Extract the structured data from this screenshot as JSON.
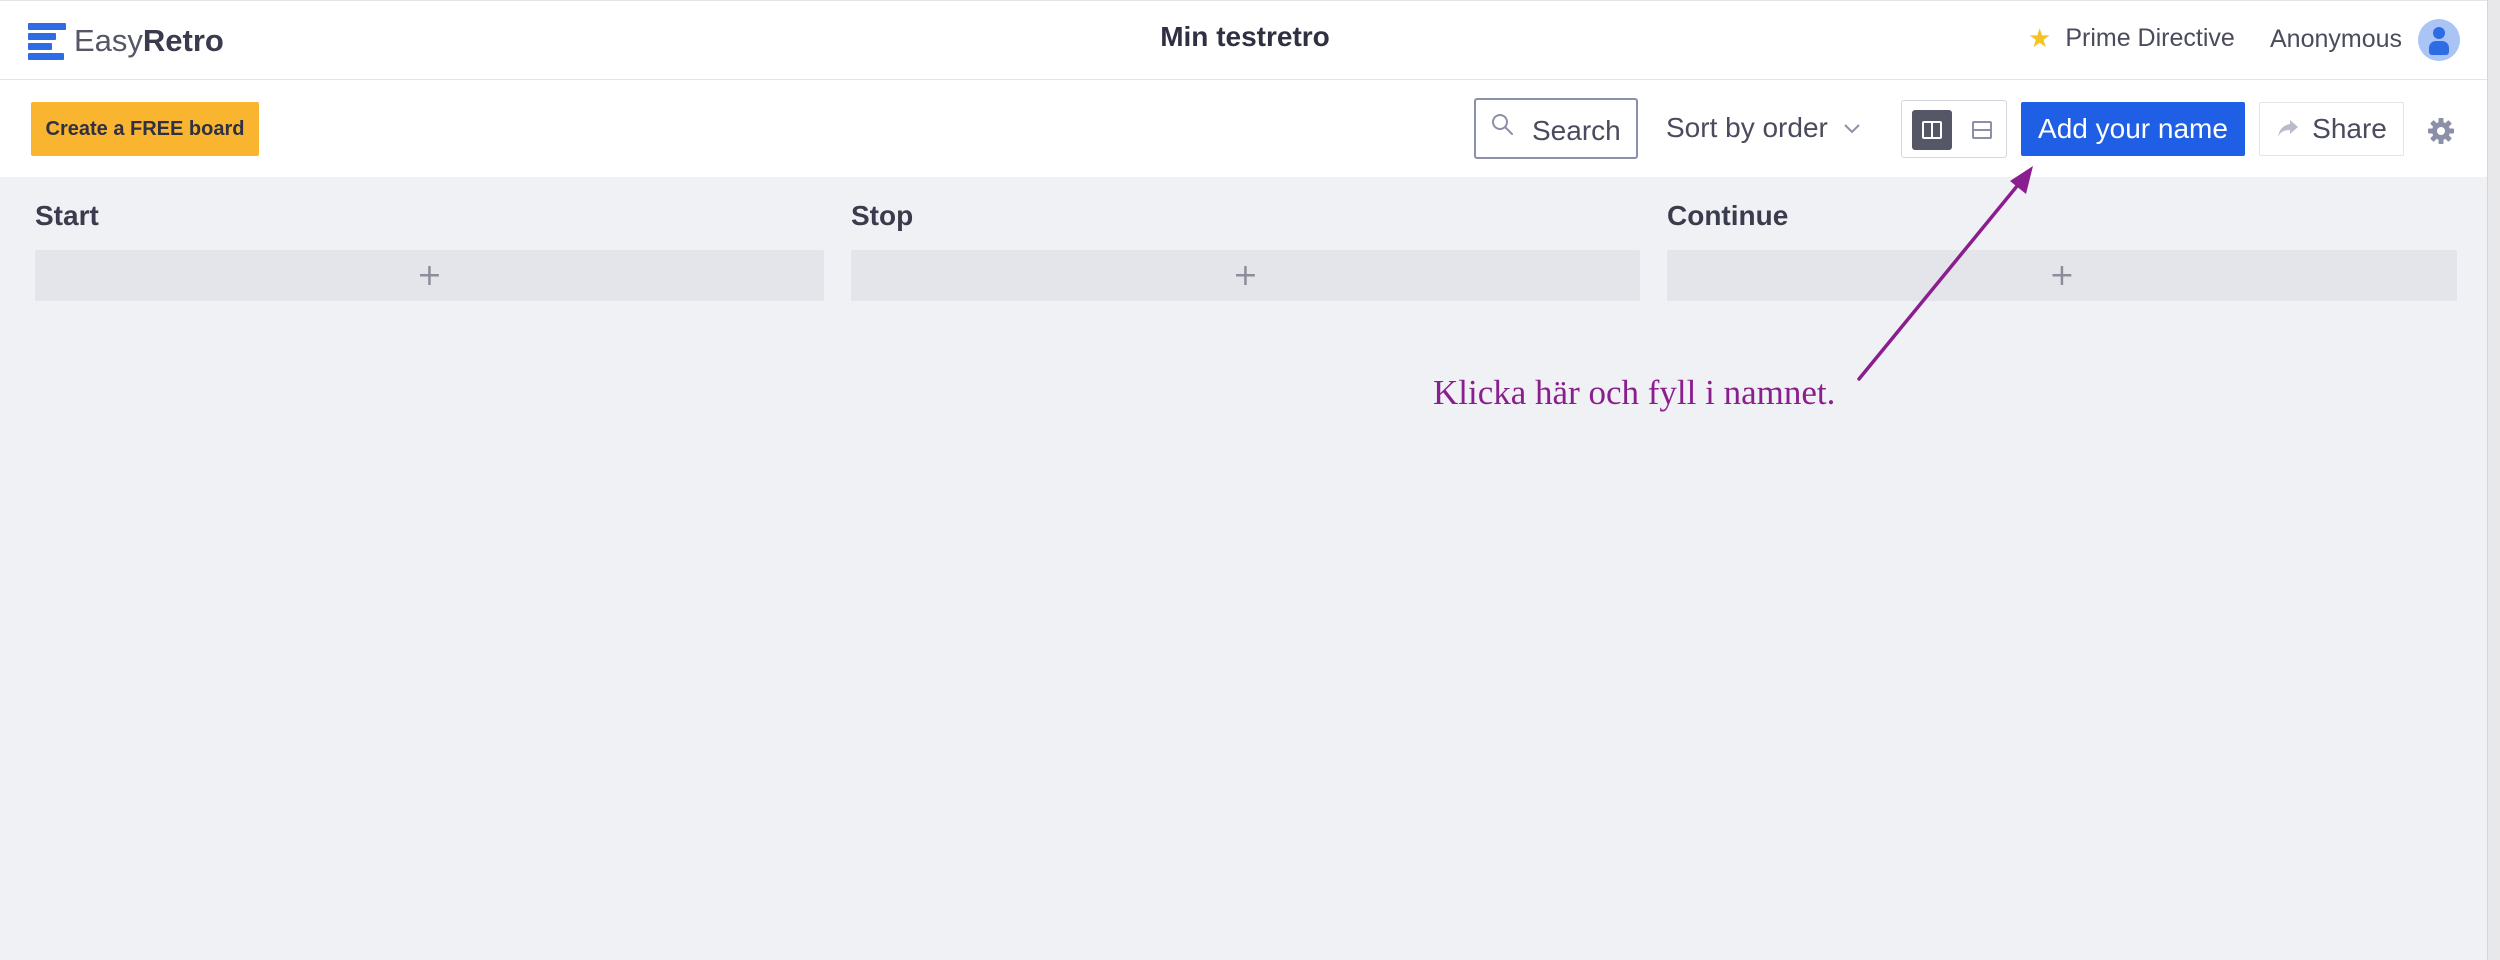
{
  "header": {
    "logo_easy": "Easy",
    "logo_retro": "Retro",
    "board_title": "Min testretro",
    "prime_directive": "Prime Directive",
    "user_name": "Anonymous"
  },
  "toolbar": {
    "create_board": "Create a FREE board",
    "search_label": "Search",
    "sort_label": "Sort by order",
    "add_name": "Add your name",
    "share": "Share"
  },
  "columns": [
    {
      "title": "Start",
      "add": "+"
    },
    {
      "title": "Stop",
      "add": "+"
    },
    {
      "title": "Continue",
      "add": "+"
    }
  ],
  "annotation": {
    "text": "Klicka här och fyll i namnet.",
    "color": "#8b1e8f"
  },
  "colors": {
    "accent": "#1f5fe5",
    "create_button": "#f9b52f",
    "star": "#f6c325"
  }
}
